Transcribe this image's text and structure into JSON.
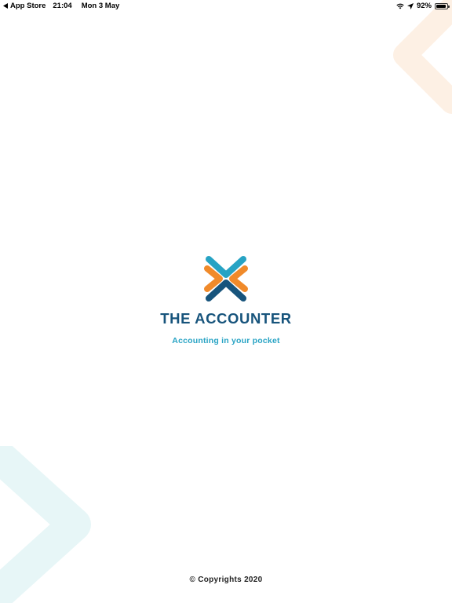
{
  "status_bar": {
    "back_app": "App Store",
    "time": "21:04",
    "date": "Mon 3 May",
    "battery_percent": "92%",
    "battery_level": 0.92,
    "icons": [
      "back-arrow-icon",
      "wifi-icon",
      "location-arrow-icon",
      "battery-icon"
    ]
  },
  "brand": {
    "name_part1": "THE ACCOUNT",
    "name_e": "E",
    "name_part2": "R",
    "tagline": "Accounting in your pocket"
  },
  "footer": {
    "copyright": "© Copyrights 2020"
  },
  "colors": {
    "navy": "#17547c",
    "teal": "#27a3c4",
    "orange": "#f08a2a",
    "deco_orange": "#fdf0e4",
    "deco_teal": "#e7f6f7"
  }
}
